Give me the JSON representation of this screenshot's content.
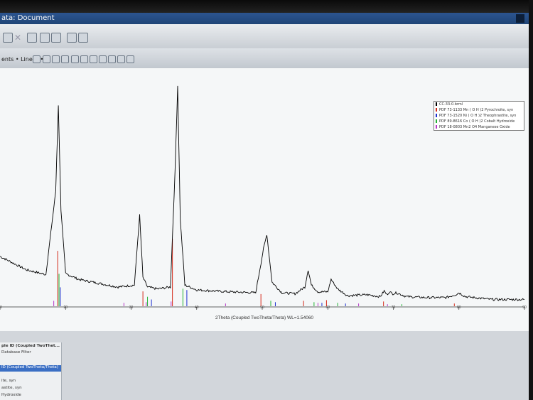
{
  "window": {
    "title": "ata: Document"
  },
  "toolbar2": {
    "scale_label": "ents • Linear •"
  },
  "chart_data": {
    "type": "line",
    "xlabel": "2Theta (Coupled TwoTheta/Theta) WL=1.54060",
    "xlim": [
      10,
      90
    ],
    "x_ticks": [
      10,
      20,
      30,
      40,
      50,
      60,
      70,
      80,
      90
    ],
    "legend_position": "top-right",
    "series": [
      {
        "name": "CC-33-0.brml",
        "color": "#000000",
        "x": [
          10,
          14,
          17,
          18.5,
          18.9,
          19.3,
          20,
          22,
          25,
          28,
          30.5,
          31.3,
          31.8,
          32.5,
          34,
          36,
          36.7,
          37.1,
          37.5,
          38.2,
          40,
          45,
          49,
          50.2,
          50.7,
          51.5,
          53,
          55,
          56.5,
          57,
          57.5,
          58.5,
          60,
          60.5,
          61.5,
          63,
          66,
          68,
          68.6,
          69,
          69.4,
          69.9,
          70.5,
          72,
          75,
          78,
          79.5,
          80,
          81,
          85,
          90
        ],
        "y": [
          52,
          38,
          33,
          120,
          210,
          100,
          34,
          28,
          24,
          20,
          22,
          95,
          30,
          20,
          18,
          20,
          140,
          230,
          90,
          22,
          17,
          15,
          14,
          60,
          75,
          25,
          14,
          13,
          20,
          38,
          22,
          15,
          15,
          28,
          18,
          11,
          12,
          10,
          16,
          12,
          15,
          13,
          14,
          10,
          9,
          9,
          12,
          14,
          10,
          7,
          7
        ]
      }
    ],
    "reference_patterns": [
      {
        "name": "PDF 73-1133 Mn ( O H )2 Pyrochroite, syn",
        "color": "#d42a1a",
        "peaks": [
          [
            18.8,
            82
          ],
          [
            31.8,
            22
          ],
          [
            36.3,
            100
          ],
          [
            49.8,
            18
          ],
          [
            56.3,
            8
          ],
          [
            59.8,
            9
          ],
          [
            68.5,
            7
          ],
          [
            79.3,
            4
          ]
        ]
      },
      {
        "name": "PDF 73-1520 Ni ( O H )2 Theophrastite, syn",
        "color": "#1c2fd0",
        "peaks": [
          [
            19.2,
            28
          ],
          [
            33.1,
            10
          ],
          [
            38.5,
            24
          ],
          [
            52.0,
            6
          ],
          [
            59.1,
            5
          ],
          [
            62.7,
            4
          ]
        ]
      },
      {
        "name": "PDF 89-8616 Co ( O H )2 Cobalt Hydroxide",
        "color": "#22b234",
        "peaks": [
          [
            19.0,
            48
          ],
          [
            32.5,
            14
          ],
          [
            37.9,
            26
          ],
          [
            51.3,
            8
          ],
          [
            57.9,
            6
          ],
          [
            61.5,
            5
          ],
          [
            71.3,
            3
          ]
        ]
      },
      {
        "name": "PDF 18-0803 Mn2 O4 Manganese Oxide",
        "color": "#b633c8",
        "peaks": [
          [
            18.2,
            8
          ],
          [
            28.9,
            5
          ],
          [
            32.3,
            6
          ],
          [
            36.1,
            7
          ],
          [
            44.4,
            4
          ],
          [
            58.5,
            5
          ],
          [
            64.7,
            4
          ],
          [
            69.1,
            3
          ]
        ]
      }
    ]
  },
  "sidepanel": {
    "header": "ple ID (Coupled TwoThet...",
    "filter": "Database Filter",
    "selected": "ID (Coupled TwoTheta/Theta)",
    "items": [
      "ite, syn",
      "astite, syn",
      "Hydroxide"
    ]
  }
}
